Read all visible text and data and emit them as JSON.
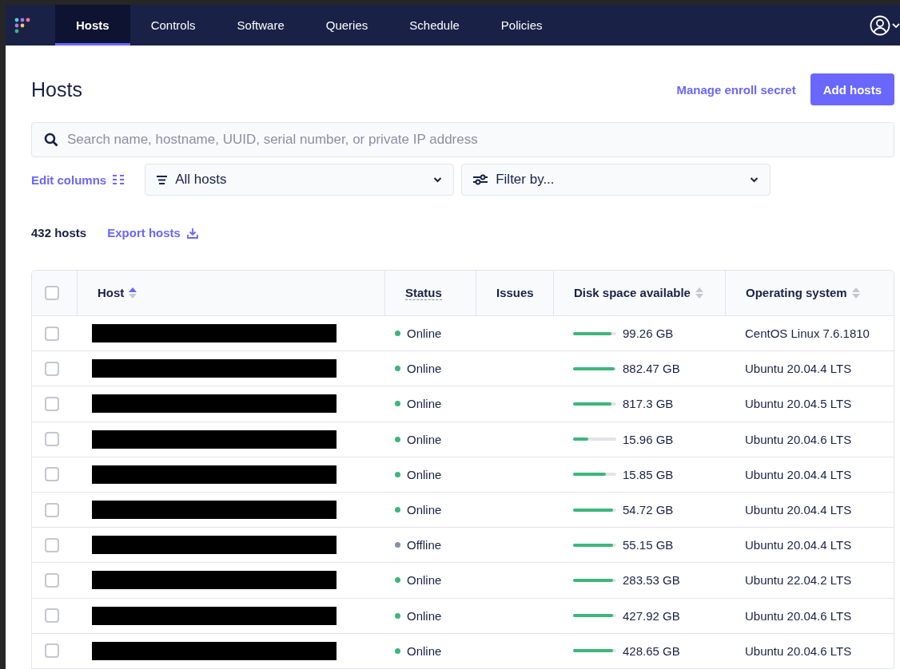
{
  "nav": {
    "items": [
      {
        "label": "Hosts",
        "selected": true
      },
      {
        "label": "Controls",
        "selected": false
      },
      {
        "label": "Software",
        "selected": false
      },
      {
        "label": "Queries",
        "selected": false
      },
      {
        "label": "Schedule",
        "selected": false
      },
      {
        "label": "Policies",
        "selected": false
      }
    ]
  },
  "header": {
    "title": "Hosts",
    "link": "Manage enroll secret",
    "button": "Add hosts"
  },
  "search": {
    "placeholder": "Search name, hostname, UUID, serial number, or private IP address"
  },
  "filters": {
    "edit_columns": "Edit columns",
    "hosts_select": "All hosts",
    "filter_select": "Filter by..."
  },
  "summary": {
    "count": "432 hosts",
    "export": "Export hosts"
  },
  "table": {
    "select_all_checked": false,
    "columns": [
      {
        "label": "Host",
        "kind": "sort"
      },
      {
        "label": "Status",
        "kind": "tooltip"
      },
      {
        "label": "Issues",
        "kind": "plain"
      },
      {
        "label": "Disk space available",
        "kind": "sort"
      },
      {
        "label": "Operating system",
        "kind": "sort"
      }
    ],
    "rows": [
      {
        "checked": false,
        "status": "Online",
        "color": "#3db67b",
        "level": 0.88,
        "disk": "99.26 GB",
        "os": "CentOS Linux 7.6.1810"
      },
      {
        "checked": false,
        "status": "Online",
        "color": "#3db67b",
        "level": 0.96,
        "disk": "882.47 GB",
        "os": "Ubuntu 20.04.4 LTS"
      },
      {
        "checked": false,
        "status": "Online",
        "color": "#3db67b",
        "level": 0.88,
        "disk": "817.3 GB",
        "os": "Ubuntu 20.04.5 LTS"
      },
      {
        "checked": false,
        "status": "Online",
        "color": "#3db67b",
        "level": 0.36,
        "disk": "15.96 GB",
        "os": "Ubuntu 20.04.6 LTS"
      },
      {
        "checked": false,
        "status": "Online",
        "color": "#3db67b",
        "level": 0.75,
        "disk": "15.85 GB",
        "os": "Ubuntu 20.04.4 LTS"
      },
      {
        "checked": false,
        "status": "Online",
        "color": "#3db67b",
        "level": 0.92,
        "disk": "54.72 GB",
        "os": "Ubuntu 20.04.4 LTS"
      },
      {
        "checked": false,
        "status": "Offline",
        "color": "#8b8fa2",
        "level": 0.92,
        "disk": "55.15 GB",
        "os": "Ubuntu 20.04.4 LTS"
      },
      {
        "checked": false,
        "status": "Online",
        "color": "#3db67b",
        "level": 0.92,
        "disk": "283.53 GB",
        "os": "Ubuntu 22.04.2 LTS"
      },
      {
        "checked": false,
        "status": "Online",
        "color": "#3db67b",
        "level": 0.92,
        "disk": "427.92 GB",
        "os": "Ubuntu 20.04.6 LTS"
      },
      {
        "checked": false,
        "status": "Online",
        "color": "#3db67b",
        "level": 0.92,
        "disk": "428.65 GB",
        "os": "Ubuntu 20.04.6 LTS"
      }
    ]
  }
}
